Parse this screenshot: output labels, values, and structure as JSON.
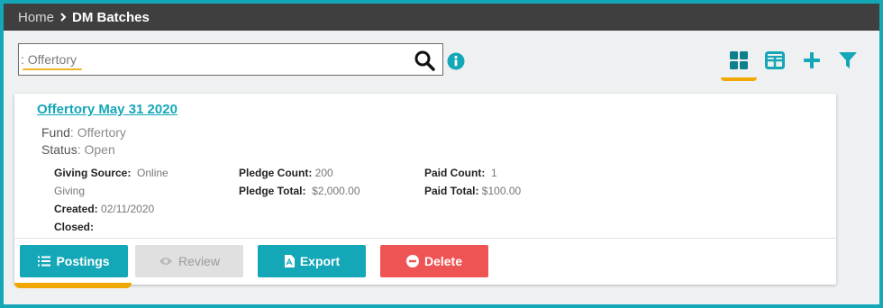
{
  "breadcrumb": {
    "home": "Home",
    "current": "DM Batches"
  },
  "search": {
    "value": ": Offertory",
    "placeholder": ""
  },
  "toolbar": {
    "icons": [
      "grid-view-icon",
      "table-view-icon",
      "plus-icon",
      "filter-icon"
    ],
    "active_view": "grid"
  },
  "batch": {
    "title": "Offertory May 31 2020",
    "fund_label": "Fund",
    "fund_value": "Offertory",
    "status_label": "Status",
    "status_value": "Open",
    "giving_source_label": "Giving Source:",
    "giving_source_value": "Online Giving",
    "created_label": "Created:",
    "created_value": "02/11/2020",
    "closed_label": "Closed:",
    "closed_value": "",
    "pledge_count_label": "Pledge Count:",
    "pledge_count_value": "200",
    "pledge_total_label": "Pledge Total:",
    "pledge_total_value": "$2,000.00",
    "paid_count_label": "Paid Count:",
    "paid_count_value": "1",
    "paid_total_label": "Paid Total:",
    "paid_total_value": "$100.00"
  },
  "actions": {
    "postings": "Postings",
    "review": "Review",
    "export": "Export",
    "delete": "Delete"
  },
  "colors": {
    "accent": "#14a7b8",
    "delete": "#ef5454",
    "highlight": "#f0a800",
    "topbar": "#3f3f3f"
  }
}
